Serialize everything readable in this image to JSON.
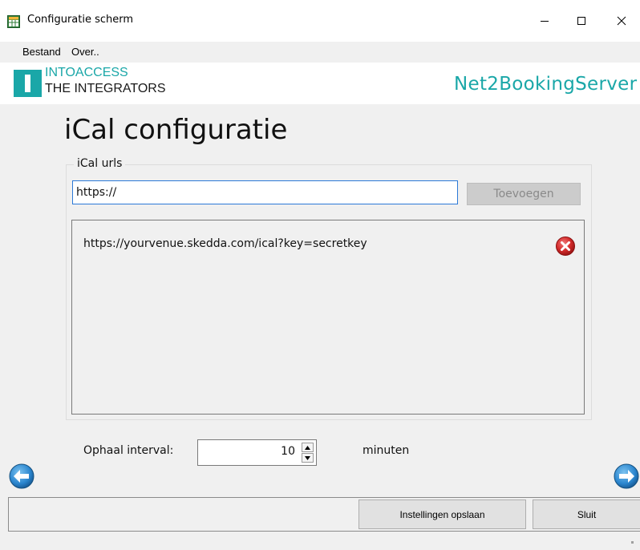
{
  "window": {
    "title": "Configuratie scherm",
    "icon": "table-grid-icon"
  },
  "menu": {
    "items": [
      {
        "label": "Bestand"
      },
      {
        "label": "Over.."
      }
    ]
  },
  "banner": {
    "company_line1": "INTOACCESS",
    "company_line2": "THE INTEGRATORS",
    "product": "Net2BookingServer",
    "accent_color": "#1aa7a8"
  },
  "page": {
    "title": "iCal configuratie"
  },
  "ical": {
    "group_label": "iCal urls",
    "url_input_value": "https://",
    "add_button_label": "Toevoegen",
    "urls": [
      {
        "url": "https://yourvenue.skedda.com/ical?key=secretkey"
      }
    ]
  },
  "interval": {
    "label": "Ophaal interval:",
    "value": "10",
    "unit": "minuten"
  },
  "footer": {
    "save_label": "Instellingen opslaan",
    "close_label": "Sluit"
  }
}
